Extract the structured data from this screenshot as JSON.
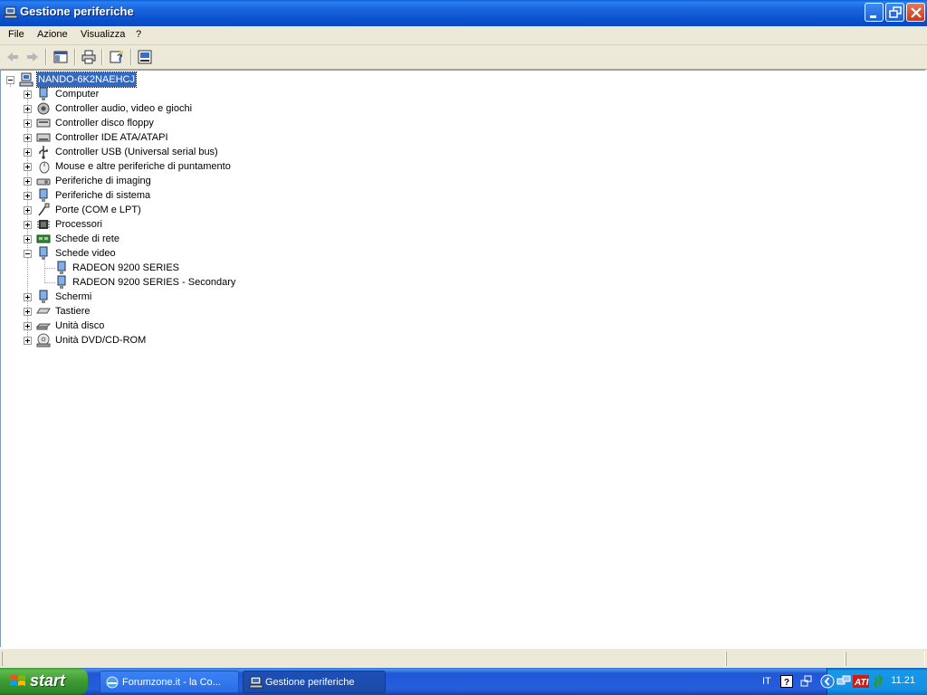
{
  "window": {
    "title": "Gestione periferiche"
  },
  "menu": [
    "File",
    "Azione",
    "Visualizza",
    "?"
  ],
  "toolbar": {
    "back": "back-arrow-icon",
    "forward": "forward-arrow-icon",
    "show_hide_tree": "console-tree-icon",
    "print": "printer-icon",
    "help": "help-icon",
    "properties": "properties-icon"
  },
  "tree": {
    "root": "NANDO-6K2NAEHCJ",
    "items": [
      {
        "label": "Computer",
        "icon": "computer-icon",
        "expanded": false
      },
      {
        "label": "Controller audio, video e giochi",
        "icon": "speaker-icon",
        "expanded": false
      },
      {
        "label": "Controller disco floppy",
        "icon": "floppy-controller-icon",
        "expanded": false
      },
      {
        "label": "Controller IDE ATA/ATAPI",
        "icon": "ide-controller-icon",
        "expanded": false
      },
      {
        "label": "Controller USB (Universal serial bus)",
        "icon": "usb-icon",
        "expanded": false
      },
      {
        "label": "Mouse e altre periferiche di puntamento",
        "icon": "mouse-icon",
        "expanded": false
      },
      {
        "label": "Periferiche di imaging",
        "icon": "scanner-icon",
        "expanded": false
      },
      {
        "label": "Periferiche di sistema",
        "icon": "system-device-icon",
        "expanded": false
      },
      {
        "label": "Porte (COM e LPT)",
        "icon": "port-icon",
        "expanded": false
      },
      {
        "label": "Processori",
        "icon": "processor-icon",
        "expanded": false
      },
      {
        "label": "Schede di rete",
        "icon": "network-card-icon",
        "expanded": false
      },
      {
        "label": "Schede video",
        "icon": "display-adapter-icon",
        "expanded": true,
        "children": [
          "RADEON 9200 SERIES",
          "RADEON 9200 SERIES - Secondary"
        ]
      },
      {
        "label": "Schermi",
        "icon": "monitor-icon",
        "expanded": false
      },
      {
        "label": "Tastiere",
        "icon": "keyboard-icon",
        "expanded": false
      },
      {
        "label": "Unità disco",
        "icon": "disk-drive-icon",
        "expanded": false
      },
      {
        "label": "Unità DVD/CD-ROM",
        "icon": "cdrom-icon",
        "expanded": false
      }
    ]
  },
  "taskbar": {
    "start": "start",
    "tasks": [
      "Forumzone.it - la Co...",
      "Gestione periferiche"
    ],
    "tray": {
      "language": "IT",
      "clock": "11.21"
    }
  },
  "colors": {
    "titlebar": "#0b53cf",
    "selection": "#316ac5",
    "start": "#3d9a32",
    "taskbar": "#245edb"
  }
}
